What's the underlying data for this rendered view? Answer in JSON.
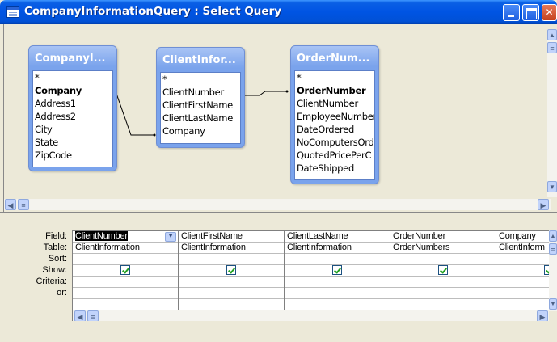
{
  "window": {
    "title": "CompanyInformationQuery : Select Query"
  },
  "tables": [
    {
      "title": "CompanyI...",
      "fields": [
        {
          "name": "*",
          "key": false
        },
        {
          "name": "Company",
          "key": true
        },
        {
          "name": "Address1",
          "key": false
        },
        {
          "name": "Address2",
          "key": false
        },
        {
          "name": "City",
          "key": false
        },
        {
          "name": "State",
          "key": false
        },
        {
          "name": "ZipCode",
          "key": false
        }
      ]
    },
    {
      "title": "ClientInfor...",
      "fields": [
        {
          "name": "*",
          "key": false
        },
        {
          "name": "ClientNumber",
          "key": false
        },
        {
          "name": "ClientFirstName",
          "key": false
        },
        {
          "name": "ClientLastName",
          "key": false
        },
        {
          "name": "Company",
          "key": false
        }
      ]
    },
    {
      "title": "OrderNum...",
      "fields": [
        {
          "name": "*",
          "key": false
        },
        {
          "name": "OrderNumber",
          "key": true
        },
        {
          "name": "ClientNumber",
          "key": false
        },
        {
          "name": "EmployeeNumber",
          "key": false
        },
        {
          "name": "DateOrdered",
          "key": false
        },
        {
          "name": "NoComputersOrd",
          "key": false
        },
        {
          "name": "QuotedPricePerC",
          "key": false
        },
        {
          "name": "DateShipped",
          "key": false
        }
      ]
    }
  ],
  "grid": {
    "row_labels": [
      "Field:",
      "Table:",
      "Sort:",
      "Show:",
      "Criteria:",
      "or:"
    ],
    "columns": [
      {
        "field": "ClientNumber",
        "table": "ClientInformation",
        "show": true
      },
      {
        "field": "ClientFirstName",
        "table": "ClientInformation",
        "show": true
      },
      {
        "field": "ClientLastName",
        "table": "ClientInformation",
        "show": true
      },
      {
        "field": "OrderNumber",
        "table": "OrderNumbers",
        "show": true
      },
      {
        "field": "Company",
        "table": "ClientInform",
        "show": true
      }
    ]
  }
}
